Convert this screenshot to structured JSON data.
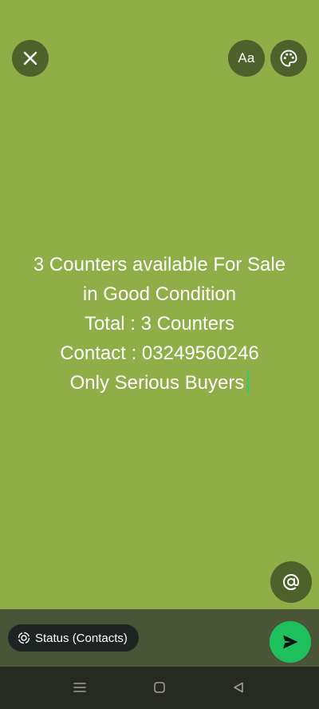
{
  "status_text": {
    "lines": [
      "3 Counters available For Sale",
      "in Good Condition",
      "Total : 3 Counters",
      "Contact : 03249560246",
      "Only Serious Buyers"
    ]
  },
  "toolbar": {
    "font_button_label": "Aa"
  },
  "bottom_bar": {
    "audience_label": "Status (Contacts)"
  },
  "colors": {
    "background": "#8fae47",
    "button_bg": "#4f612b",
    "bottom_bar_bg": "#4a5436",
    "send_button": "#1fc15f",
    "cursor": "#25d366",
    "nav_bar_bg": "#262a20"
  },
  "icons": {
    "close": "close-icon",
    "font": "font-icon",
    "palette": "palette-icon",
    "mention": "at-sign-icon",
    "audience": "status-ring-icon",
    "send": "send-icon",
    "nav_menu": "menu-icon",
    "nav_home": "home-icon",
    "nav_back": "back-icon"
  }
}
